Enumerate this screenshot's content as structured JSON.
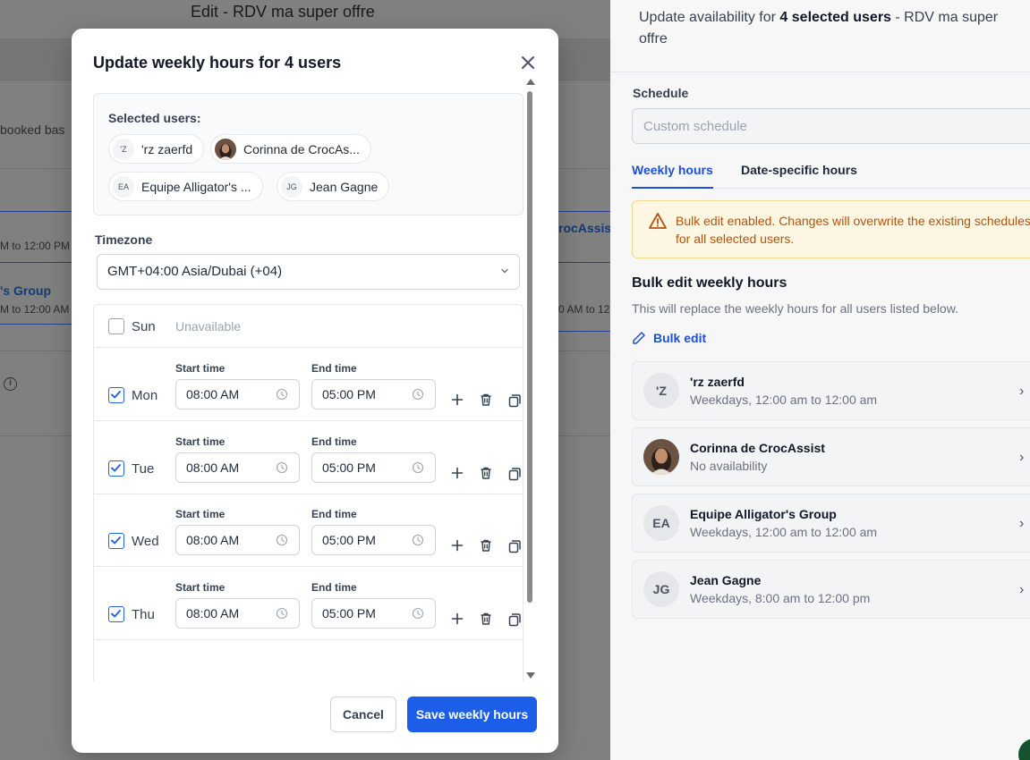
{
  "background": {
    "title": "Edit - RDV ma super offre",
    "booked_text": "booked bas",
    "time_a": "M to 12:00 PM",
    "group_link": "'s Group",
    "time_b": "M to 12:00 AM",
    "crocassist_link": "rocAssis",
    "time_c": "0 AM to 12"
  },
  "panel": {
    "header_prefix": "Update availability for ",
    "header_bold": "4 selected users",
    "header_suffix": " - RDV ma super offre",
    "schedule_label": "Schedule",
    "schedule_value": "Custom schedule",
    "tabs": [
      "Weekly hours",
      "Date-specific hours"
    ],
    "alert": "Bulk edit enabled. Changes will overwrite the existing schedules for all selected users.",
    "bulk_title": "Bulk edit weekly hours",
    "bulk_desc": "This will replace the weekly hours for all users listed below.",
    "bulk_link": "Bulk edit",
    "users": [
      {
        "initials": "'Z",
        "name": "'rz zaerfd",
        "sub": "Weekdays, 12:00 am to 12:00 am"
      },
      {
        "initials": "",
        "name": "Corinna de CrocAssist",
        "sub": "No availability"
      },
      {
        "initials": "EA",
        "name": "Equipe Alligator's Group",
        "sub": "Weekdays, 12:00 am to 12:00 am"
      },
      {
        "initials": "JG",
        "name": "Jean Gagne",
        "sub": "Weekdays, 8:00 am to 12:00 pm"
      }
    ]
  },
  "modal": {
    "title": "Update weekly hours for 4 users",
    "selected_label": "Selected users:",
    "chips": [
      {
        "initials": "'Z",
        "name": "'rz zaerfd"
      },
      {
        "initials": "",
        "name": "Corinna de CrocAs..."
      },
      {
        "initials": "EA",
        "name": "Equipe Alligator's ..."
      },
      {
        "initials": "JG",
        "name": "Jean Gagne"
      }
    ],
    "timezone_label": "Timezone",
    "timezone_value": "GMT+04:00 Asia/Dubai (+04)",
    "start_label": "Start time",
    "end_label": "End time",
    "sunday": {
      "day": "Sun",
      "status": "Unavailable"
    },
    "days": [
      {
        "day": "Mon",
        "start": "08:00 AM",
        "end": "05:00 PM"
      },
      {
        "day": "Tue",
        "start": "08:00 AM",
        "end": "05:00 PM"
      },
      {
        "day": "Wed",
        "start": "08:00 AM",
        "end": "05:00 PM"
      },
      {
        "day": "Thu",
        "start": "08:00 AM",
        "end": "05:00 PM"
      }
    ],
    "cancel": "Cancel",
    "save": "Save weekly hours"
  },
  "colors": {
    "accent": "#1d5ee8",
    "warning_bg": "#fdf6e3",
    "warning_text": "#b45309"
  }
}
